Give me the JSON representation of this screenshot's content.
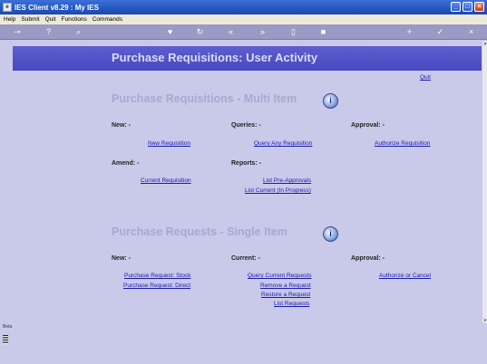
{
  "window": {
    "title": "IES Client v8.29 : My IES",
    "icon": "ies-logo-icon"
  },
  "menu": [
    "Help",
    "Submit",
    "Quit",
    "Functions",
    "Commands"
  ],
  "toolbar_icons": [
    "key-icon",
    "help-icon",
    "search-icon",
    "heart-icon",
    "refresh-icon",
    "back-icon",
    "forward-icon",
    "document-icon",
    "stop-icon",
    "add-icon",
    "check-icon",
    "close-icon"
  ],
  "banner": "Purchase Requisitions: User Activity",
  "quit_link": "Quit",
  "multi": {
    "heading": "Purchase Requisitions - Multi Item",
    "new_label": "New: -",
    "queries_label": "Queries: -",
    "approval_label": "Approval: -",
    "new_links": [
      "New Requisition"
    ],
    "query_links": [
      "Query Any Requisition"
    ],
    "approval_links": [
      "Authorize Requisition"
    ],
    "amend_label": "Amend: -",
    "reports_label": "Reports: -",
    "amend_links": [
      "Current Requisition"
    ],
    "report_links": [
      "List Pre-Approvals",
      "List Current (In Progress)"
    ]
  },
  "single": {
    "heading": "Purchase Requests - Single Item",
    "new_label": "New: -",
    "current_label": "Current: -",
    "approval_label": "Approval: -",
    "new_links": [
      "Purchase Request: Stock",
      "Purchase Request: Direct"
    ],
    "current_links": [
      "Query Current Requests",
      "Remove a Request",
      "Restore a Request",
      "List Requests"
    ],
    "approval_links": [
      "Authorize or Cancel"
    ]
  },
  "info_symbol": "i",
  "side_logo": "Beta"
}
